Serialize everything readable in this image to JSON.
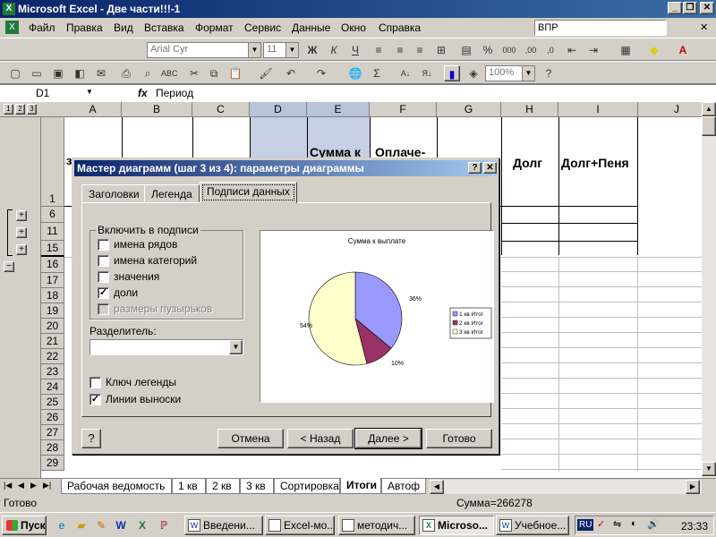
{
  "window": {
    "title": "Microsoft Excel - Две части!!!-1"
  },
  "menu": {
    "items": [
      "Файл",
      "Правка",
      "Вид",
      "Вставка",
      "Формат",
      "Сервис",
      "Данные",
      "Окно",
      "Справка"
    ],
    "search_value": "ВПР"
  },
  "toolbar": {
    "font_name": "Arial Cyr",
    "font_size": "11",
    "zoom": "100%",
    "bold": "Ж",
    "italic": "К",
    "underline": "Ч"
  },
  "formula_bar": {
    "cell_ref": "D1",
    "fx": "fx",
    "value": "Период"
  },
  "grid": {
    "outline_levels": [
      "1",
      "2",
      "3"
    ],
    "columns": [
      "A",
      "B",
      "C",
      "D",
      "E",
      "F",
      "G",
      "H",
      "I",
      "J"
    ],
    "rows": [
      "1",
      "6",
      "11",
      "15",
      "16",
      "17",
      "18",
      "19",
      "20",
      "21",
      "22",
      "23",
      "24",
      "25",
      "26",
      "27",
      "28",
      "29"
    ],
    "header_e": "Сумма к",
    "header_f": "Оплаче-",
    "header_h": "Долг",
    "header_i": "Долг+Пеня",
    "cell_a1_fragment": "з"
  },
  "sheet_tabs": [
    "Рабочая ведомость",
    "1 кв",
    "2 кв",
    "3 кв",
    "Сортировка",
    "Итоги",
    "Автоф"
  ],
  "status": {
    "left": "Готово",
    "sum": "Сумма=266278"
  },
  "taskbar": {
    "start": "Пуск",
    "buttons": [
      "Введени...",
      "Excel-мо...",
      "методич...",
      "Microsо...",
      "Учебное..."
    ],
    "lang": "RU",
    "clock": "23:33"
  },
  "dialog": {
    "title": "Мастер диаграмм (шаг 3 из 4): параметры диаграммы",
    "help_btn": "?",
    "close_btn": "✕",
    "tabs": [
      "Заголовки",
      "Легенда",
      "Подписи данных"
    ],
    "group_label": "Включить в подписи",
    "options": [
      {
        "label": "имена рядов",
        "checked": false,
        "disabled": false
      },
      {
        "label": "имена категорий",
        "checked": false,
        "disabled": false
      },
      {
        "label": "значения",
        "checked": false,
        "disabled": false
      },
      {
        "label": "доли",
        "checked": true,
        "disabled": false
      },
      {
        "label": "размеры пузырьков",
        "checked": false,
        "disabled": true
      }
    ],
    "separator_label": "Разделитель:",
    "separator_value": "",
    "legend_key": {
      "label": "Ключ легенды",
      "checked": false
    },
    "leader_lines": {
      "label": "Линии выноски",
      "checked": true
    },
    "buttons": {
      "cancel": "Отмена",
      "back": "< Назад",
      "next": "Далее >",
      "finish": "Готово"
    }
  },
  "chart_data": {
    "type": "pie",
    "title": "Сумма к выплате",
    "categories": [
      "1 кв Итог",
      "2 кв Итог",
      "3 кв Итог"
    ],
    "values": [
      36,
      10,
      54
    ],
    "labels": [
      "36%",
      "10%",
      "54%"
    ],
    "colors": [
      "#9999ff",
      "#993366",
      "#ffffcc"
    ],
    "legend": "right"
  }
}
